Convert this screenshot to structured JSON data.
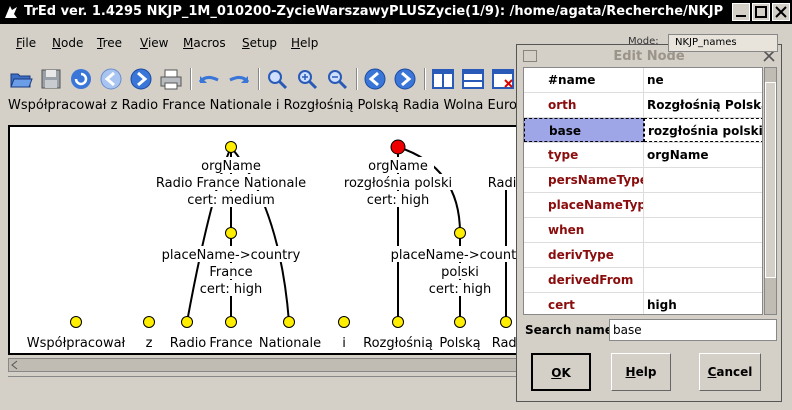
{
  "window": {
    "title": "TrEd ver. 1.4295    NKJP_1M_010200-ZycieWarszawyPLUSZycie(1/9): /home/agata/Recherche/NKJP"
  },
  "menu": [
    {
      "label": "File",
      "key": "F",
      "rest": "ile"
    },
    {
      "label": "Node",
      "key": "N",
      "rest": "ode"
    },
    {
      "label": "Tree",
      "key": "T",
      "rest": "ree"
    },
    {
      "label": "View",
      "key": "V",
      "rest": "iew"
    },
    {
      "label": "Macros",
      "key": "M",
      "rest": "acros"
    },
    {
      "label": "Setup",
      "key": "S",
      "rest": "etup"
    },
    {
      "label": "Help",
      "key": "H",
      "rest": "elp"
    }
  ],
  "sentence": "Współpracował z Radio France Nationale i Rozgłośnią Polską Radia Wolna Europa",
  "tree": {
    "nodes": [
      {
        "lines": [
          "orgName",
          "Radio France Nationale",
          "cert: medium"
        ]
      },
      {
        "lines": [
          "placeName->country",
          "France",
          "cert: high"
        ]
      },
      {
        "lines": [
          "orgName",
          "rozgłośnia polski",
          "cert: high"
        ]
      },
      {
        "lines": [
          "placeName->country",
          "polski",
          "cert: high"
        ]
      },
      {
        "lines": [
          "Radio"
        ]
      }
    ],
    "tokens": [
      "Współpracował",
      "z",
      "Radio",
      "France",
      "Nationale",
      "i",
      "Rozgłośnią",
      "Polską",
      "Radia"
    ]
  },
  "edit_node": {
    "title": "Edit Node",
    "mode_label": "Mode:",
    "mode_value": "NKJP_names",
    "attributes": [
      {
        "name": "#name",
        "value": "ne"
      },
      {
        "name": "orth",
        "value": "Rozgłośnią Polską"
      },
      {
        "name": "base",
        "value": "rozgłośnia polski"
      },
      {
        "name": "type",
        "value": "orgName"
      },
      {
        "name": "persNameType",
        "value": ""
      },
      {
        "name": "placeNameType",
        "value": ""
      },
      {
        "name": "when",
        "value": ""
      },
      {
        "name": "derivType",
        "value": ""
      },
      {
        "name": "derivedFrom",
        "value": ""
      },
      {
        "name": "cert",
        "value": "high"
      }
    ],
    "search_label": "Search name:",
    "search_value": "base",
    "buttons": {
      "ok": {
        "key": "O",
        "rest": "K"
      },
      "help": {
        "key": "H",
        "rest": "elp"
      },
      "cancel": {
        "key": "C",
        "rest": "ancel"
      }
    }
  },
  "colors": {
    "attr_name": "#8a0c0c",
    "selected_row": "#9ea6e8",
    "node_fill": "#ffee00",
    "current_node_fill": "#ee0000"
  }
}
